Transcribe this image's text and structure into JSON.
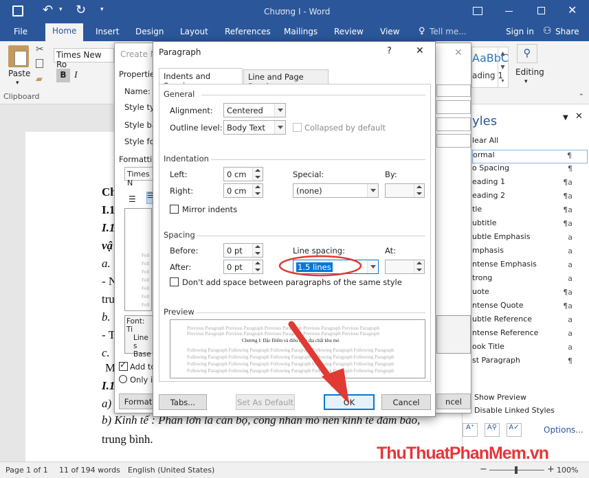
{
  "window": {
    "title": "Chương I - Word"
  },
  "ribbon_tabs": {
    "file": "File",
    "home": "Home",
    "insert": "Insert",
    "design": "Design",
    "layout": "Layout",
    "references": "References",
    "mailings": "Mailings",
    "review": "Review",
    "view": "View",
    "tellme": "Tell me...",
    "signin": "Sign in",
    "share": "Share"
  },
  "ribbon": {
    "paste": "Paste",
    "clipboard": "Clipboard",
    "font_name": "Times New Ro",
    "bold": "B",
    "italic": "I",
    "styles_sample": "AaBbC",
    "styles_heading": "ading 1",
    "editing": "Editing"
  },
  "create_style": {
    "title": "Create N",
    "properties": "Properties",
    "name": "Name:",
    "style_type": "Style typ",
    "style_based": "Style ba",
    "style_following": "Style for",
    "formatting": "Formattin",
    "font_box": "Times N",
    "preview_lines": "Foll",
    "desc1": "Font: Ti",
    "desc2": "Line s",
    "desc3": "Base",
    "add_to": "Add to",
    "only_in": "Only in",
    "format_btn": "Format",
    "cancel_btn": "ncel"
  },
  "paragraph": {
    "title": "Paragraph",
    "help": "?",
    "tabs": {
      "indents": "Indents and Spacing",
      "breaks": "Line and Page Breaks"
    },
    "general": {
      "header": "General",
      "alignment_label": "Alignment:",
      "alignment_value": "Centered",
      "outline_label": "Outline level:",
      "outline_value": "Body Text",
      "collapsed": "Collapsed by default"
    },
    "indentation": {
      "header": "Indentation",
      "left_label": "Left:",
      "left_value": "0 cm",
      "right_label": "Right:",
      "right_value": "0 cm",
      "special_label": "Special:",
      "special_value": "(none)",
      "by_label": "By:",
      "mirror": "Mirror indents"
    },
    "spacing": {
      "header": "Spacing",
      "before_label": "Before:",
      "before_value": "0 pt",
      "after_label": "After:",
      "after_value": "0 pt",
      "line_label": "Line spacing:",
      "line_value": "1.5 lines",
      "at_label": "At:",
      "dont_add": "Don't add space between paragraphs of the same style"
    },
    "preview": {
      "header": "Preview",
      "prev": "Previous Paragraph Previous Paragraph Previous Paragraph Previous Paragraph Previous Paragraph",
      "current": "Chương I: Đặc Điểm và điều kiện địa chất khu mỏ",
      "following": "Following Paragraph Following Paragraph Following Paragraph Following Paragraph Following Paragraph"
    },
    "buttons": {
      "tabs": "Tabs...",
      "default": "Set As Default",
      "ok": "OK",
      "cancel": "Cancel"
    }
  },
  "styles_pane": {
    "title": "yles",
    "items": [
      "lear All",
      "ormal",
      "o Spacing",
      "eading 1",
      "eading 2",
      "tle",
      "ubtitle",
      "ubtle Emphasis",
      "mphasis",
      "ntense Emphasis",
      "trong",
      "uote",
      "ntense Quote",
      "ubtle Reference",
      "ntense Reference",
      "ook Title",
      "st Paragraph"
    ],
    "icons": [
      "",
      "¶",
      "¶",
      "¶a",
      "¶a",
      "¶a",
      "¶a",
      "a",
      "a",
      "a",
      "a",
      "¶a",
      "¶a",
      "a",
      "a",
      "a",
      "¶"
    ],
    "show_preview": "Show Preview",
    "disable_linked": "Disable Linked Styles",
    "options": "Options..."
  },
  "document": {
    "lines": [
      "Ch",
      "I.1",
      "I.1",
      "vậ",
      "a.",
      "- N",
      "tru",
      "b.",
      "- T",
      "c.",
      "M",
      "I.1",
      "a)"
    ],
    "kinh_te": "b) Kinh tế : Phần lớn là cán bộ, công nhân mỏ nên kinh tế đảm bảo,",
    "trung_binh": "trung bình."
  },
  "status": {
    "page": "Page 1 of 1",
    "words": "11 of 194 words",
    "lang": "English (United States)",
    "zoom": "100%"
  },
  "watermark": "ThuThuatPhanMem.vn",
  "colors": {
    "word_blue": "#2b579a",
    "ok_border": "#0078d7",
    "annotation_red": "#e03a32"
  }
}
